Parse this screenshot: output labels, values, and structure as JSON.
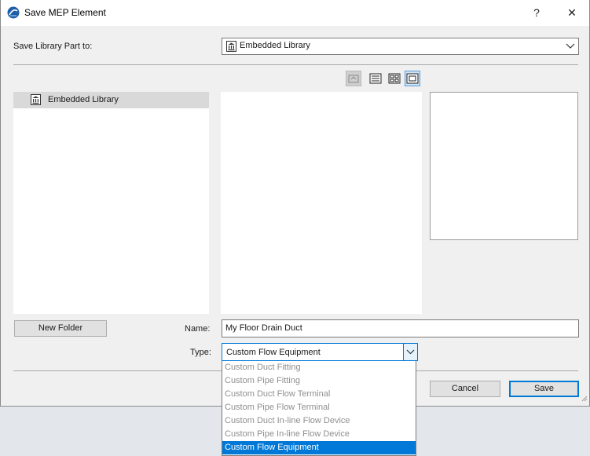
{
  "window": {
    "title": "Save MEP Element",
    "help_label": "?",
    "close_label": "✕"
  },
  "save_to": {
    "label": "Save Library Part to:",
    "selected": "Embedded Library"
  },
  "tree": {
    "items": [
      {
        "label": "Embedded Library",
        "icon": "library-icon"
      }
    ]
  },
  "view_buttons": [
    "up-folder-icon",
    "list-view-icon",
    "grid-view-icon",
    "preview-view-icon"
  ],
  "new_folder_label": "New Folder",
  "name_field": {
    "label": "Name:",
    "value": "My Floor Drain Duct"
  },
  "type_field": {
    "label": "Type:",
    "selected": "Custom Flow Equipment",
    "options": [
      "Custom Duct Fitting",
      "Custom Pipe Fitting",
      "Custom Duct Flow Terminal",
      "Custom Pipe Flow Terminal",
      "Custom Duct In-line Flow Device",
      "Custom Pipe In-line Flow Device",
      "Custom Flow Equipment"
    ]
  },
  "actions": {
    "cancel_label": "Cancel",
    "save_label": "Save"
  },
  "colors": {
    "accent": "#0078d7",
    "selection_bg": "#d9d9d9",
    "dialog_bg": "#f0f0f0"
  }
}
